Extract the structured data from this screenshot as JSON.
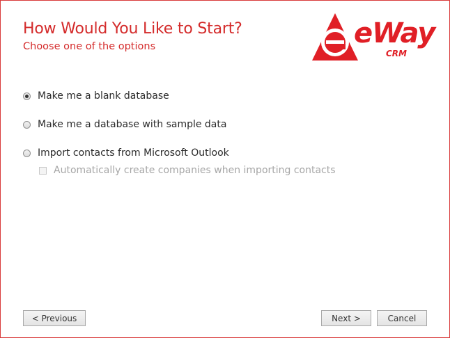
{
  "header": {
    "title": "How Would You Like to Start?",
    "subtitle": "Choose one of the options"
  },
  "logo": {
    "text": "eWay",
    "sub": "CRM",
    "color": "#e01f26"
  },
  "options": [
    {
      "label": "Make me a blank database",
      "selected": true
    },
    {
      "label": "Make me a database with sample data",
      "selected": false
    },
    {
      "label": "Import contacts from Microsoft Outlook",
      "selected": false
    }
  ],
  "sub_option": {
    "label": "Automatically create companies when importing contacts",
    "checked": false,
    "enabled": false
  },
  "buttons": {
    "previous": "< Previous",
    "next": "Next >",
    "cancel": "Cancel"
  },
  "colors": {
    "accent": "#d42b2b",
    "border": "#d93a3a"
  }
}
